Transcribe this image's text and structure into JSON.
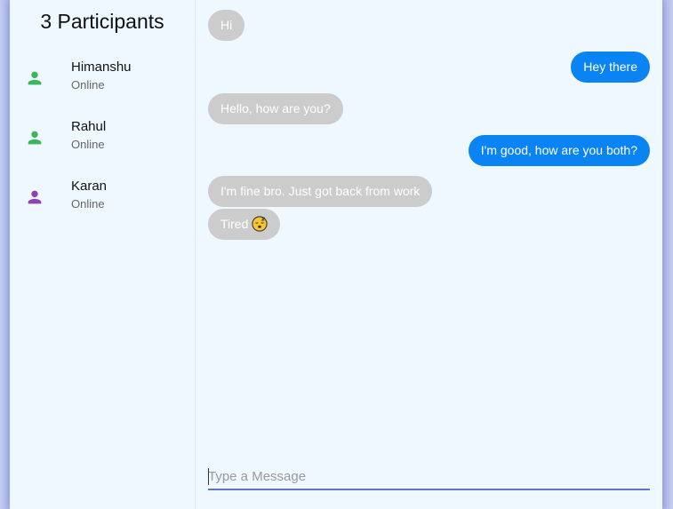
{
  "sidebar": {
    "title": "3 Participants",
    "participants": [
      {
        "name": "Himanshu",
        "status": "Online",
        "icon": "person-icon",
        "color": "#3cb55e"
      },
      {
        "name": "Rahul",
        "status": "Online",
        "icon": "person-icon",
        "color": "#3cb55e"
      },
      {
        "name": "Karan",
        "status": "Online",
        "icon": "person-icon",
        "color": "#8e44ad"
      }
    ]
  },
  "chat": {
    "messages": [
      {
        "side": "left",
        "text": "Hi"
      },
      {
        "side": "right",
        "text": "Hey there"
      },
      {
        "side": "left",
        "text": "Hello, how are you?"
      },
      {
        "side": "right",
        "text": "I'm good, how are you both?"
      },
      {
        "side": "left",
        "text": "I'm fine bro. Just got back from work"
      },
      {
        "side": "left",
        "text": "Tired",
        "emoji": "sleeping-face-icon"
      }
    ],
    "input": {
      "value": "",
      "placeholder": "Type a Message"
    }
  },
  "colors": {
    "sent_bubble": "#0b84f3",
    "received_bubble": "#cccccc",
    "background": "#eff7ff",
    "input_underline": "#6272c4"
  }
}
